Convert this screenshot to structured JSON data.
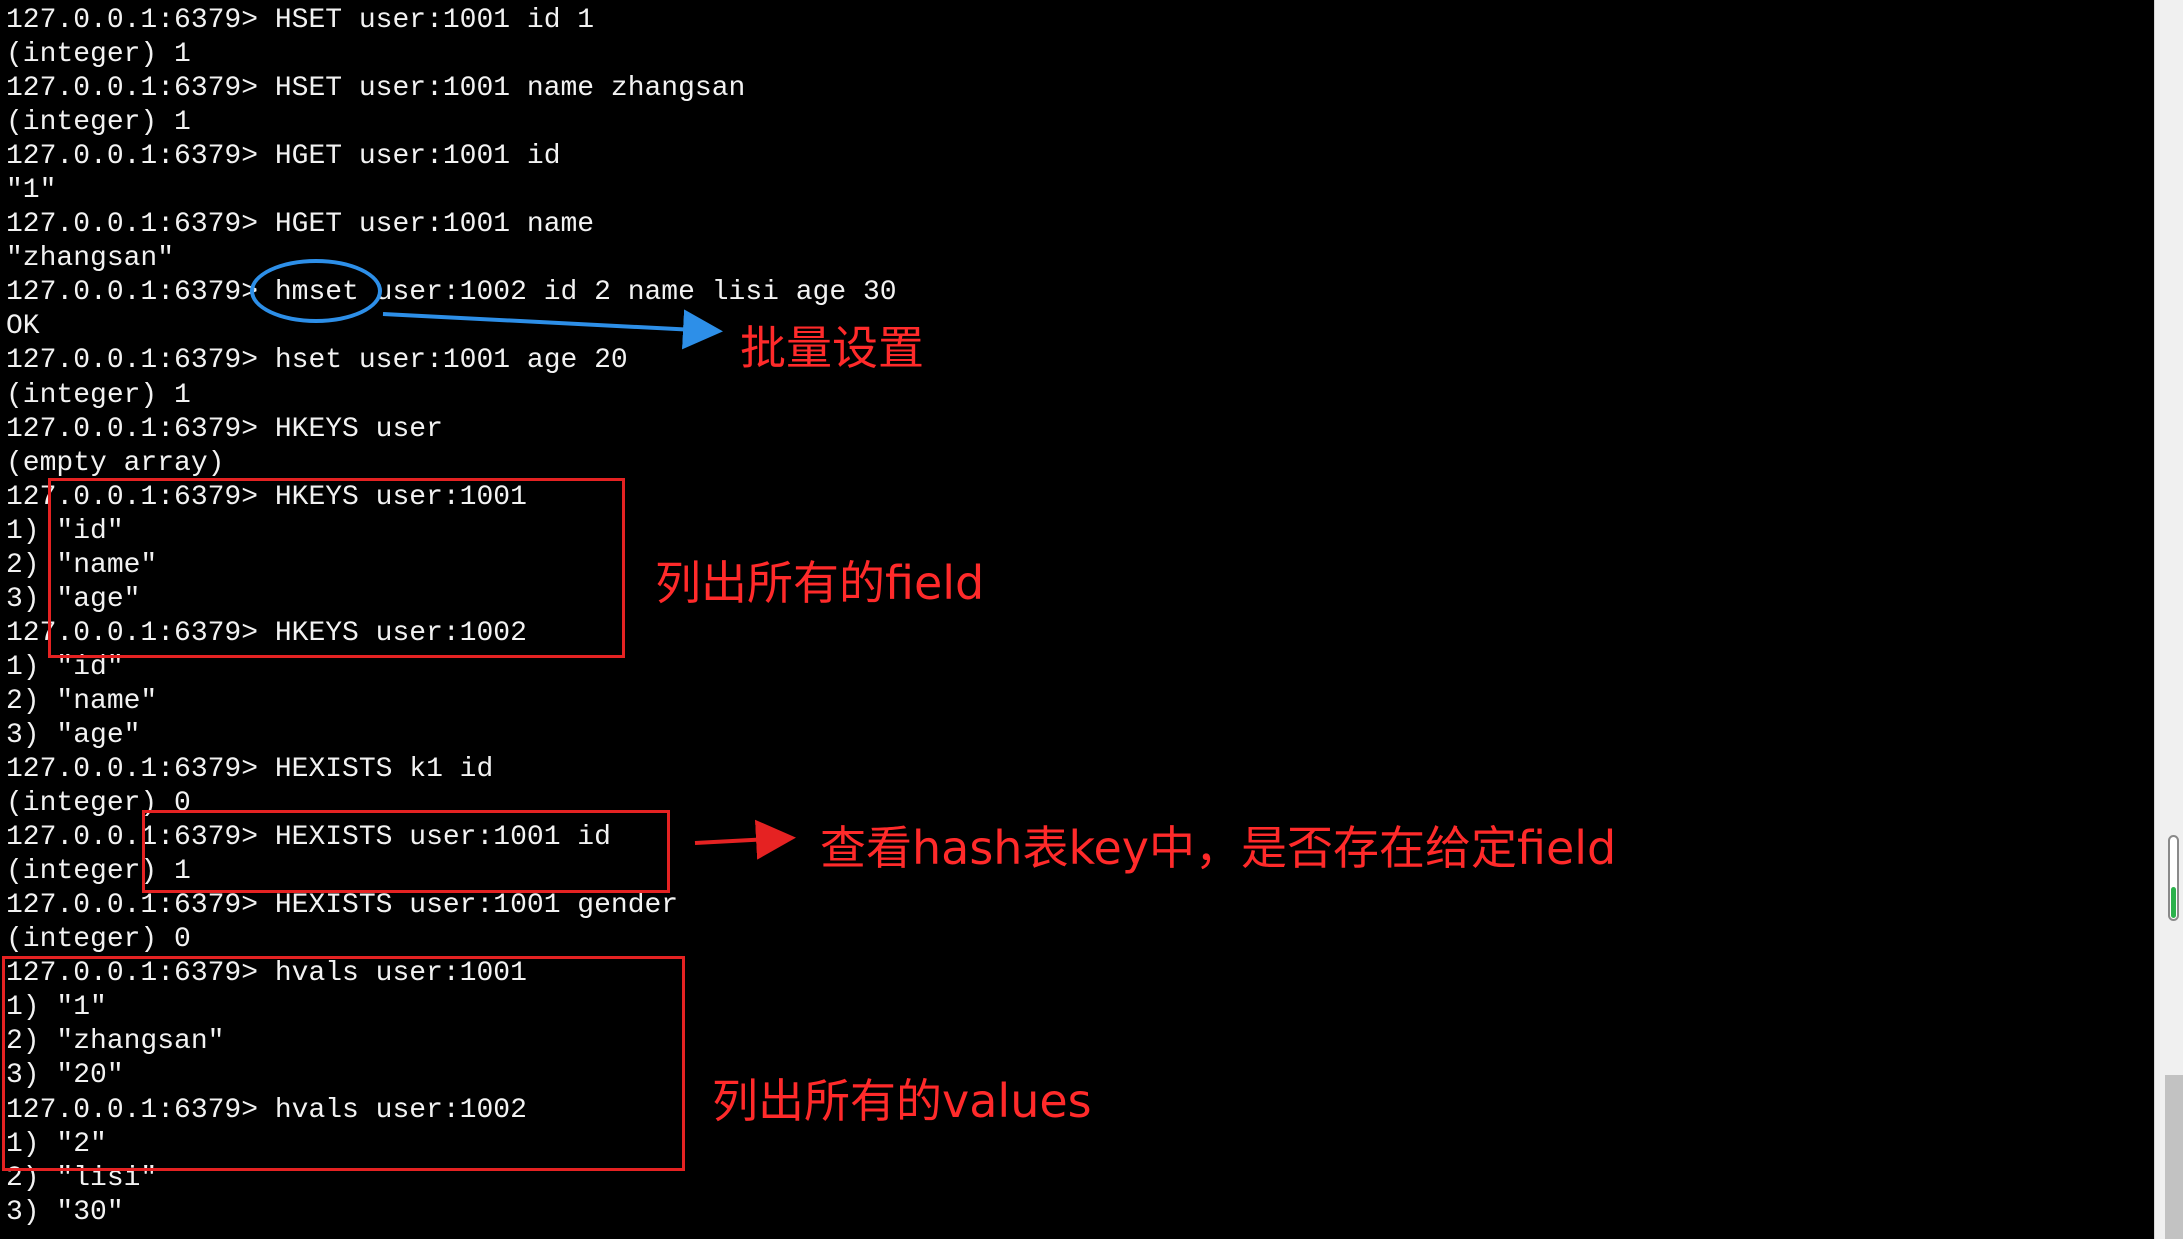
{
  "terminal": {
    "lines": [
      "127.0.0.1:6379> HSET user:1001 id 1",
      "(integer) 1",
      "127.0.0.1:6379> HSET user:1001 name zhangsan",
      "(integer) 1",
      "127.0.0.1:6379> HGET user:1001 id",
      "\"1\"",
      "127.0.0.1:6379> HGET user:1001 name",
      "\"zhangsan\"",
      "127.0.0.1:6379> hmset user:1002 id 2 name lisi age 30",
      "OK",
      "127.0.0.1:6379> hset user:1001 age 20",
      "(integer) 1",
      "127.0.0.1:6379> HKEYS user",
      "(empty array)",
      "127.0.0.1:6379> HKEYS user:1001",
      "1) \"id\"",
      "2) \"name\"",
      "3) \"age\"",
      "127.0.0.1:6379> HKEYS user:1002",
      "1) \"id\"",
      "2) \"name\"",
      "3) \"age\"",
      "127.0.0.1:6379> HEXISTS k1 id",
      "(integer) 0",
      "127.0.0.1:6379> HEXISTS user:1001 id",
      "(integer) 1",
      "127.0.0.1:6379> HEXISTS user:1001 gender",
      "(integer) 0",
      "127.0.0.1:6379> hvals user:1001",
      "1) \"1\"",
      "2) \"zhangsan\"",
      "3) \"20\"",
      "127.0.0.1:6379> hvals user:1002",
      "1) \"2\"",
      "2) \"lisi\"",
      "3) \"30\""
    ]
  },
  "annotations": {
    "hmset_note": "批量设置",
    "hkeys_note": "列出所有的field",
    "hexists_note": "查看hash表key中，是否存在给定field",
    "hvals_note": "列出所有的values"
  },
  "scrollbar": {
    "gauge_level": 0.4
  },
  "colors": {
    "background": "#000000",
    "text": "#f2f2f2",
    "annotation_red": "#ff2a2a",
    "annotation_blue": "#2d8fe8",
    "gauge_green": "#2bb24c"
  }
}
